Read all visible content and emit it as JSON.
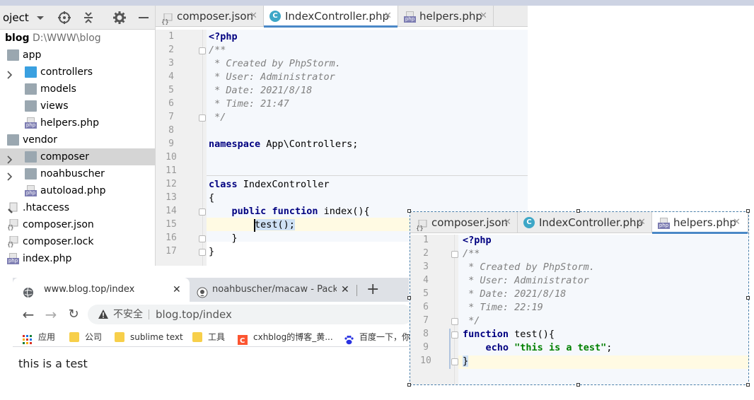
{
  "project": {
    "title": "oject",
    "root": {
      "name": "blog",
      "path": "D:\\WWW\\blog"
    },
    "items": [
      {
        "label": "app",
        "type": "folder"
      },
      {
        "label": "controllers",
        "type": "folder-blue"
      },
      {
        "label": "models",
        "type": "folder"
      },
      {
        "label": "views",
        "type": "folder"
      },
      {
        "label": "helpers.php",
        "type": "php"
      },
      {
        "label": "vendor",
        "type": "folder"
      },
      {
        "label": "composer",
        "type": "folder"
      },
      {
        "label": "noahbuscher",
        "type": "folder"
      },
      {
        "label": "autoload.php",
        "type": "php"
      },
      {
        "label": ".htaccess",
        "type": "htaccess"
      },
      {
        "label": "composer.json",
        "type": "json"
      },
      {
        "label": "composer.lock",
        "type": "json"
      },
      {
        "label": "index.php",
        "type": "php"
      }
    ]
  },
  "editor1": {
    "tabs": [
      {
        "label": "composer.json",
        "icon": "json"
      },
      {
        "label": "IndexController.php",
        "icon": "class"
      },
      {
        "label": "helpers.php",
        "icon": "php"
      }
    ],
    "line_numbers": [
      "1",
      "2",
      "3",
      "4",
      "5",
      "6",
      "7",
      "8",
      "9",
      "10",
      "11",
      "12",
      "13",
      "14",
      "15",
      "16",
      "17"
    ],
    "lines": {
      "l1": "<?php",
      "l2": "/**",
      "l3": " * Created by PhpStorm.",
      "l4": " * User: Administrator",
      "l5": " * Date: 2021/8/18",
      "l6": " * Time: 21:47",
      "l7": " */",
      "l9_kw": "namespace",
      "l9_rest": " App\\Controllers;",
      "l12_kw": "class",
      "l12_rest": " IndexController",
      "l13": "{",
      "l14_kw1": "public",
      "l14_kw2": "function",
      "l14_rest": " index(){",
      "l15": "test();",
      "l16": "}",
      "l17": "}"
    }
  },
  "editor2": {
    "tabs": [
      {
        "label": "composer.json",
        "icon": "json"
      },
      {
        "label": "IndexController.php",
        "icon": "class"
      },
      {
        "label": "helpers.php",
        "icon": "php"
      }
    ],
    "line_numbers": [
      "1",
      "2",
      "3",
      "4",
      "5",
      "6",
      "7",
      "8",
      "9",
      "10"
    ],
    "lines": {
      "l1": "<?php",
      "l2": "/**",
      "l3": " * Created by PhpStorm.",
      "l4": " * User: Administrator",
      "l5": " * Date: 2021/8/18",
      "l6": " * Time: 22:19",
      "l7": " */",
      "l8_kw": "function",
      "l8_rest": " test(){",
      "l9_kw": "echo",
      "l9_str": "\"this is a test\"",
      "l9_end": ";",
      "l10": "}"
    }
  },
  "browser": {
    "tabs": [
      {
        "label": "www.blog.top/index"
      },
      {
        "label": "noahbuscher/macaw - Packag"
      }
    ],
    "new_tab": "+",
    "insecure_label": "不安全",
    "url": "blog.top/index",
    "bookmarks": [
      {
        "label": "应用"
      },
      {
        "label": "公司"
      },
      {
        "label": "sublime text"
      },
      {
        "label": "工具"
      },
      {
        "label": "cxhblog的博客_黄..."
      },
      {
        "label": "百度一下，你"
      }
    ],
    "page_text": "this is a test"
  },
  "colors": {
    "keyword": "#000080",
    "comment": "#808080",
    "string": "#008000",
    "selection": "#214283",
    "active_tab_underline": "#4a88c7",
    "current_line": "#fffae3"
  }
}
